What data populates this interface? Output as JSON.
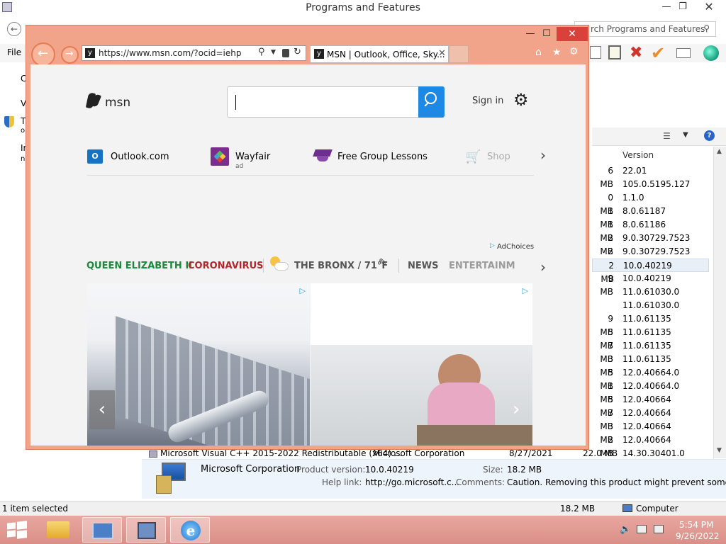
{
  "background_window": {
    "title": "Programs and Features",
    "search_placeholder": "rch Programs and Features",
    "menu_file": "File",
    "left_fragments": [
      "C",
      "V",
      "T",
      "o",
      "In",
      "n"
    ],
    "col_header_version": "Version",
    "rows": [
      {
        "size": "6 MB",
        "version": "22.01"
      },
      {
        "size": "",
        "version": "105.0.5195.127"
      },
      {
        "size": "0 MB",
        "version": "1.1.0"
      },
      {
        "size": "1 MB",
        "version": "8.0.61187"
      },
      {
        "size": "1 MB",
        "version": "8.0.61186"
      },
      {
        "size": "2 MB",
        "version": "9.0.30729.7523"
      },
      {
        "size": "2 MB",
        "version": "9.0.30729.7523"
      },
      {
        "size": "2 MB",
        "version": "10.0.40219"
      },
      {
        "size": "9 MB",
        "version": "10.0.40219"
      },
      {
        "size": "",
        "version": "11.0.61030.0"
      },
      {
        "size": "",
        "version": "11.0.61030.0"
      },
      {
        "size": "9 MB",
        "version": "11.0.61135"
      },
      {
        "size": "5 MB",
        "version": "11.0.61135"
      },
      {
        "size": "7 MB",
        "version": "11.0.61135"
      },
      {
        "size": "3 MB",
        "version": "11.0.61135"
      },
      {
        "size": "5 MB",
        "version": "12.0.40664.0"
      },
      {
        "size": "1 MB",
        "version": "12.0.40664.0"
      },
      {
        "size": "5 MB",
        "version": "12.0.40664"
      },
      {
        "size": "7 MB",
        "version": "12.0.40664"
      },
      {
        "size": "3 MB",
        "version": "12.0.40664"
      },
      {
        "size": "2 MB",
        "version": "12.0.40664"
      }
    ],
    "bottom_row": {
      "name": "Microsoft Visual C++ 2015-2022 Redistributable (x64) ...",
      "publisher": "Microsoft Corporation",
      "date": "8/27/2021",
      "size": "22.0 MB",
      "version": "14.30.30401.0"
    },
    "details": {
      "publisher": "Microsoft Corporation",
      "product_version_label": "Product version:",
      "product_version": "10.0.40219",
      "size_label": "Size:",
      "size": "18.2 MB",
      "help_link_label": "Help link:",
      "help_link": "http://go.microsoft.c...",
      "comments_label": "Comments:",
      "comments": "Caution. Removing this product might prevent some a..."
    },
    "status": {
      "selected": "1 item selected",
      "size": "18.2 MB",
      "location": "Computer"
    }
  },
  "taskbar": {
    "time": "5:54 PM",
    "date": "9/26/2022"
  },
  "ie": {
    "url": "https://www.msn.com/?ocid=iehp",
    "tab_title": "MSN | Outlook, Office, Sky...",
    "msn": {
      "logo_text": "msn",
      "sign_in": "Sign in",
      "quick_links": [
        {
          "label": "Outlook.com",
          "sub": ""
        },
        {
          "label": "Wayfair",
          "sub": "ad"
        },
        {
          "label": "Free Group Lessons",
          "sub": ""
        },
        {
          "label": "Shop",
          "sub": ""
        }
      ],
      "ad_choices": "AdChoices",
      "categories": [
        {
          "label": "QUEEN ELIZABETH II",
          "color": "#1a8a3a"
        },
        {
          "label": "CORONAVIRUS",
          "color": "#b3262b"
        },
        {
          "label": "THE BRONX / 71°F",
          "color": "#555555"
        },
        {
          "label": "NEWS",
          "color": "#555555"
        },
        {
          "label": "ENTERTAINM",
          "color": "#777777"
        }
      ]
    }
  }
}
